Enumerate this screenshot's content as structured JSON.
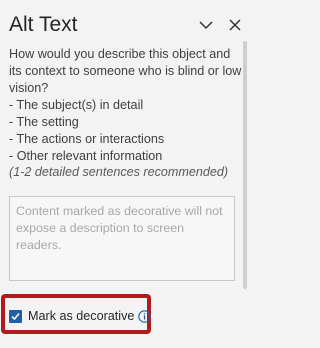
{
  "panel": {
    "title": "Alt Text",
    "instructions": "How would you describe this object and its context to someone who is blind or low vision?\n- The subject(s) in detail\n- The setting\n- The actions or interactions\n- Other relevant information",
    "recommendation": "(1-2 detailed sentences recommended)"
  },
  "description_field": {
    "placeholder": "Content marked as decorative will not expose a description to screen readers.",
    "value": ""
  },
  "decorative_checkbox": {
    "label": "Mark as decorative",
    "checked": true
  },
  "colors": {
    "accent": "#1f5fa8",
    "highlight": "#b11b1b",
    "background": "#f3f3f3"
  },
  "icons": [
    "chevron-down-icon",
    "close-icon",
    "checkmark-icon",
    "info-icon"
  ]
}
